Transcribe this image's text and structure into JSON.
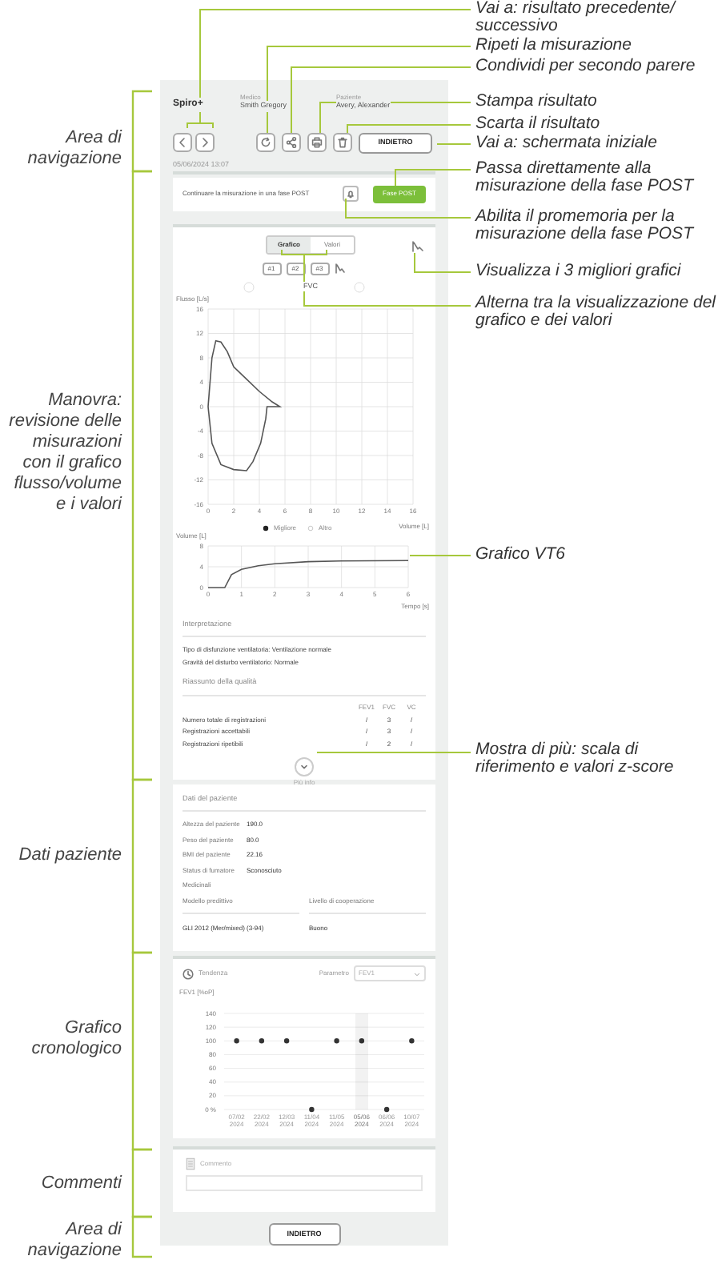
{
  "side_labels": [
    "Area di navigazione",
    "Manovra: revisione delle misurazioni con il grafico flusso/volume e i valori",
    "Dati paziente",
    "Grafico cronologico",
    "Commenti",
    "Area di navigazione"
  ],
  "callouts": [
    "Vai a: risultato precedente/ successivo",
    "Ripeti la misurazione",
    "Condividi per secondo parere",
    "Stampa risultato",
    "Scarta il risultato",
    "Vai a: schermata iniziale",
    "Passa direttamente alla misurazione della fase POST",
    "Abilita il promemoria per la misurazione della fase POST",
    "Visualizza i 3 migliori grafici",
    "Alterna tra la visualizzazione del grafico e dei valori",
    "Grafico VT6",
    "Mostra di più: scala di riferimento e valori z-score"
  ],
  "header": {
    "app_name": "Spiro+",
    "operator_label": "Medico",
    "operator": "Smith Gregory",
    "patient_label": "Paziente",
    "patient": "Avery, Alexander",
    "back_button": "INDIETRO"
  },
  "date": "05/06/2024 13:07",
  "post_banner": {
    "message": "Continuare la misurazione in una fase POST",
    "button": "Fase POST"
  },
  "maneuver": {
    "view_toggle": [
      {
        "label": "Grafico",
        "selected": true
      },
      {
        "label": "Valori",
        "selected": false
      }
    ],
    "trials": [
      "#1",
      "#2",
      "#3"
    ],
    "title": "FVC",
    "flow_chart": {
      "chart_data": {
        "type": "line",
        "xlabel": "Volume [L]",
        "ylabel": "Flusso [L/s]",
        "xlim": [
          0,
          16
        ],
        "ylim": [
          -16,
          16
        ],
        "xticks": [
          0,
          2,
          4,
          6,
          8,
          10,
          12,
          14,
          16
        ],
        "yticks": [
          16,
          12,
          8,
          4,
          0,
          -4,
          -8,
          -12,
          -16
        ],
        "grid": true
      }
    },
    "legend": [
      {
        "label": "Migliore",
        "kind": "filled"
      },
      {
        "label": "Altro",
        "kind": "hollow"
      }
    ],
    "vt_chart": {
      "chart_data": {
        "type": "line",
        "xlabel": "Tempo [s]",
        "ylabel": "Volume [L]",
        "x": [
          0,
          0.5,
          0.7,
          1,
          1.5,
          2,
          3,
          4,
          6
        ],
        "series": [
          {
            "color": "#555555",
            "values": [
              0,
              0,
              2.5,
              3.5,
              4.2,
              4.6,
              5,
              5.1,
              5.2
            ]
          }
        ],
        "xlim": [
          0,
          6
        ],
        "ylim": [
          0,
          8
        ],
        "xticks": [
          0,
          1,
          2,
          3,
          4,
          5,
          6
        ],
        "yticks": [
          8,
          4,
          0
        ],
        "grid": true
      }
    },
    "interpretation": {
      "title": "Interpretazione",
      "lines": [
        "Tipo di disfunzione ventilatoria: Ventilazione normale",
        "Gravità del disturbo ventilatorio: Normale"
      ]
    },
    "quality": {
      "title": "Riassunto della qualità",
      "columns": [
        "FEV1",
        "FVC",
        "VC"
      ],
      "rows": [
        {
          "label": "Numero totale di registrazioni",
          "cells": [
            "/",
            "3",
            "/"
          ]
        },
        {
          "label": "Registrazioni accettabili",
          "cells": [
            "/",
            "3",
            "/"
          ]
        },
        {
          "label": "Registrazioni ripetibili",
          "cells": [
            "/",
            "2",
            "/"
          ]
        }
      ]
    },
    "more": "Più info"
  },
  "patient": {
    "title": "Dati del paziente",
    "fields": [
      {
        "label": "Altezza del paziente",
        "value": "190.0"
      },
      {
        "label": "Peso del paziente",
        "value": "80.0"
      },
      {
        "label": "BMI del paziente",
        "value": "22.16"
      },
      {
        "label": "Status di fumatore",
        "value": "Sconosciuto"
      },
      {
        "label": "Medicinali"
      }
    ],
    "columns": [
      "Modello predittivo",
      "Livello di cooperazione"
    ],
    "values": [
      "GLI 2012 (Mer/mixed) (3-94)",
      "Buono"
    ]
  },
  "trend": {
    "title": "Tendenza",
    "parameter_label": "Parametro",
    "parameter": "FEV1",
    "date_states": [
      {
        "selected": false
      },
      {
        "selected": false
      },
      {
        "selected": false
      },
      {
        "selected": false
      },
      {
        "selected": false
      },
      {
        "selected": true
      },
      {
        "selected": false
      },
      {
        "selected": false
      }
    ],
    "chart_data": {
      "type": "scatter",
      "ylabel": "FEV1 [%oP]",
      "categories": [
        "07/02 2024",
        "22/02 2024",
        "12/03 2024",
        "11/04 2024",
        "11/05 2024",
        "05/06 2024",
        "06/06 2024",
        "10/07 2024"
      ],
      "series": [
        {
          "color": "#333333",
          "values": [
            100,
            100,
            100,
            0,
            100,
            100,
            0,
            100
          ]
        }
      ],
      "ylim": [
        0,
        140
      ],
      "yticks": [
        140,
        120,
        100,
        80,
        60,
        40,
        20,
        {
          "value": 0,
          "label": "0 %"
        }
      ],
      "grid": true
    }
  },
  "comments": {
    "placeholder": "Commento"
  },
  "footer": {
    "back_button": "INDIETRO"
  }
}
